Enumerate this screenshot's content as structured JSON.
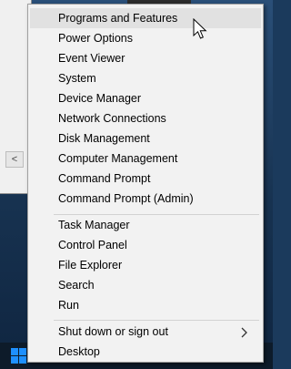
{
  "menu": {
    "group1": [
      {
        "label": "Programs and Features"
      },
      {
        "label": "Power Options"
      },
      {
        "label": "Event Viewer"
      },
      {
        "label": "System"
      },
      {
        "label": "Device Manager"
      },
      {
        "label": "Network Connections"
      },
      {
        "label": "Disk Management"
      },
      {
        "label": "Computer Management"
      },
      {
        "label": "Command Prompt"
      },
      {
        "label": "Command Prompt (Admin)"
      }
    ],
    "group2": [
      {
        "label": "Task Manager"
      },
      {
        "label": "Control Panel"
      },
      {
        "label": "File Explorer"
      },
      {
        "label": "Search"
      },
      {
        "label": "Run"
      }
    ],
    "group3": [
      {
        "label": "Shut down or sign out",
        "has_submenu": true
      },
      {
        "label": "Desktop"
      }
    ],
    "hovered_item": "Programs and Features",
    "submenu_arrow_icon": "chevron-right-icon"
  },
  "background_window": {
    "scroll_left_glyph": "<"
  },
  "taskbar": {
    "start_icon": "windows-logo-icon",
    "accent_color": "#1e90ff"
  },
  "colors": {
    "menu_background": "#f2f2f2",
    "hover_background": "#e1e1e1"
  }
}
